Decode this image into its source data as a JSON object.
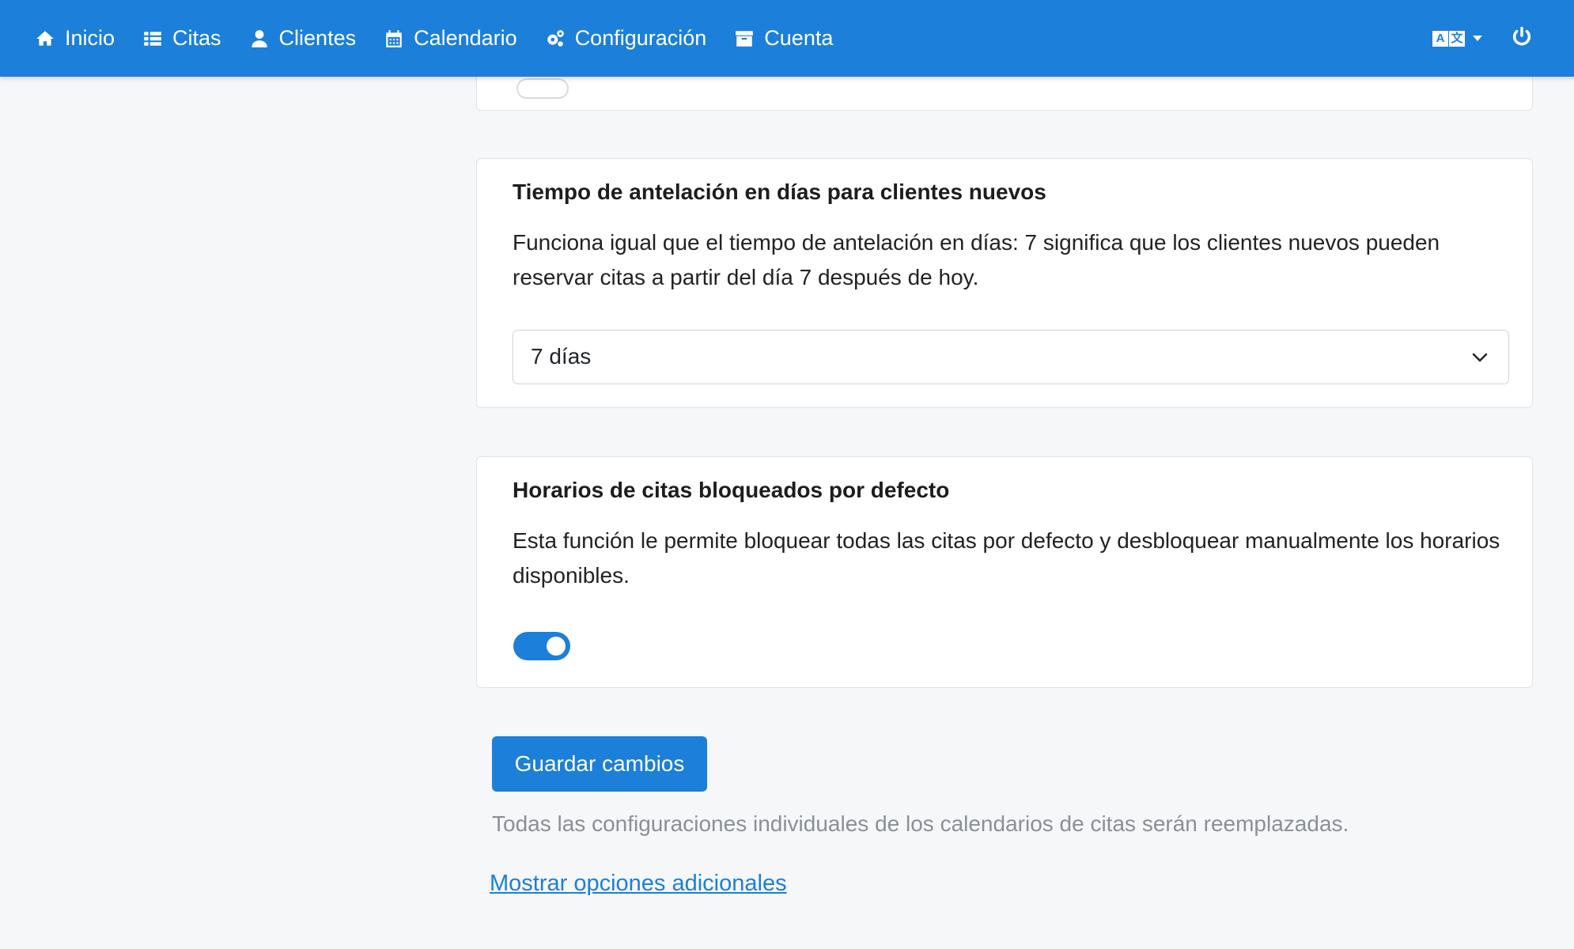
{
  "nav": {
    "items": [
      {
        "label": "Inicio",
        "icon": "home-icon"
      },
      {
        "label": "Citas",
        "icon": "list-icon"
      },
      {
        "label": "Clientes",
        "icon": "user-icon"
      },
      {
        "label": "Calendario",
        "icon": "calendar-icon"
      },
      {
        "label": "Configuración",
        "icon": "cogs-icon"
      },
      {
        "label": "Cuenta",
        "icon": "archive-icon"
      }
    ],
    "language_icon": "translate-icon",
    "power_icon": "power-icon"
  },
  "lead_time_new_clients": {
    "title": "Tiempo de antelación en días para clientes nuevos",
    "description": "Funciona igual que el tiempo de antelación en días: 7 significa que los clientes nuevos pueden reservar citas a partir del día 7 después de hoy.",
    "selected": "7 días"
  },
  "blocked_by_default": {
    "title": "Horarios de citas bloqueados por defecto",
    "description": "Esta función le permite bloquear todas las citas por defecto y desbloquear manualmente los horarios disponibles.",
    "enabled": true
  },
  "actions": {
    "save_label": "Guardar cambios",
    "note": "Todas las configuraciones individuales de los calendarios de citas serán reemplazadas.",
    "more_options": "Mostrar opciones adicionales"
  },
  "colors": {
    "primary": "#1c7fd9",
    "background": "#f6f7f9"
  }
}
